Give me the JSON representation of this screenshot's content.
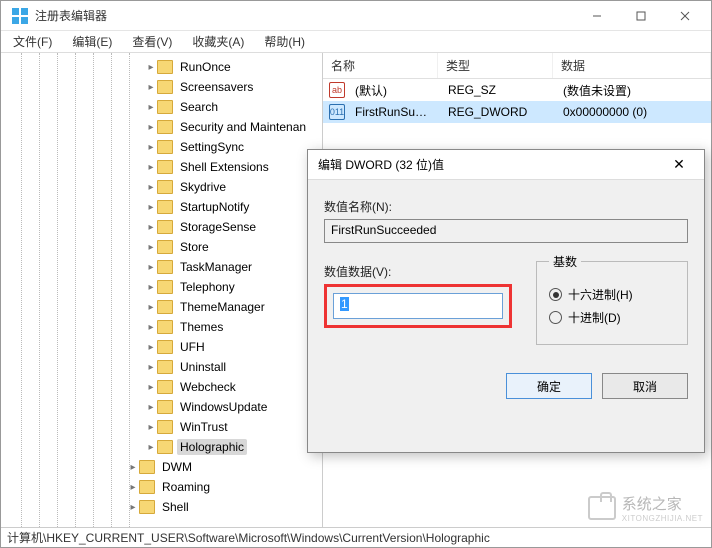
{
  "window": {
    "title": "注册表编辑器"
  },
  "menu": {
    "file": "文件(F)",
    "edit": "编辑(E)",
    "view": "查看(V)",
    "favorites": "收藏夹(A)",
    "help": "帮助(H)"
  },
  "tree": {
    "items": [
      {
        "label": "RunOnce",
        "indent": 140
      },
      {
        "label": "Screensavers",
        "indent": 140
      },
      {
        "label": "Search",
        "indent": 140
      },
      {
        "label": "Security and Maintenan",
        "indent": 140
      },
      {
        "label": "SettingSync",
        "indent": 140
      },
      {
        "label": "Shell Extensions",
        "indent": 140
      },
      {
        "label": "Skydrive",
        "indent": 140
      },
      {
        "label": "StartupNotify",
        "indent": 140
      },
      {
        "label": "StorageSense",
        "indent": 140
      },
      {
        "label": "Store",
        "indent": 140
      },
      {
        "label": "TaskManager",
        "indent": 140
      },
      {
        "label": "Telephony",
        "indent": 140
      },
      {
        "label": "ThemeManager",
        "indent": 140
      },
      {
        "label": "Themes",
        "indent": 140
      },
      {
        "label": "UFH",
        "indent": 140
      },
      {
        "label": "Uninstall",
        "indent": 140
      },
      {
        "label": "Webcheck",
        "indent": 140
      },
      {
        "label": "WindowsUpdate",
        "indent": 140
      },
      {
        "label": "WinTrust",
        "indent": 140
      },
      {
        "label": "Holographic",
        "indent": 140,
        "selected": true
      },
      {
        "label": "DWM",
        "indent": 122
      },
      {
        "label": "Roaming",
        "indent": 122
      },
      {
        "label": "Shell",
        "indent": 122
      }
    ]
  },
  "list": {
    "headers": {
      "name": "名称",
      "type": "类型",
      "data": "数据"
    },
    "rows": [
      {
        "icon": "ab",
        "iconClass": "icon-sz",
        "name": "(默认)",
        "type": "REG_SZ",
        "data": "(数值未设置)",
        "selected": false
      },
      {
        "icon": "011",
        "iconClass": "icon-dw",
        "name": "FirstRunSucce...",
        "type": "REG_DWORD",
        "data": "0x00000000 (0)",
        "selected": true
      }
    ]
  },
  "dialog": {
    "title": "编辑 DWORD (32 位)值",
    "name_label": "数值名称(N):",
    "name_value": "FirstRunSucceeded",
    "data_label": "数值数据(V):",
    "data_value": "1",
    "base_legend": "基数",
    "radio_hex": "十六进制(H)",
    "radio_dec": "十进制(D)",
    "ok": "确定",
    "cancel": "取消"
  },
  "statusbar": {
    "path": "计算机\\HKEY_CURRENT_USER\\Software\\Microsoft\\Windows\\CurrentVersion\\Holographic"
  },
  "watermark": {
    "text": "系统之家",
    "sub": "XITONGZHIJIA.NET"
  }
}
